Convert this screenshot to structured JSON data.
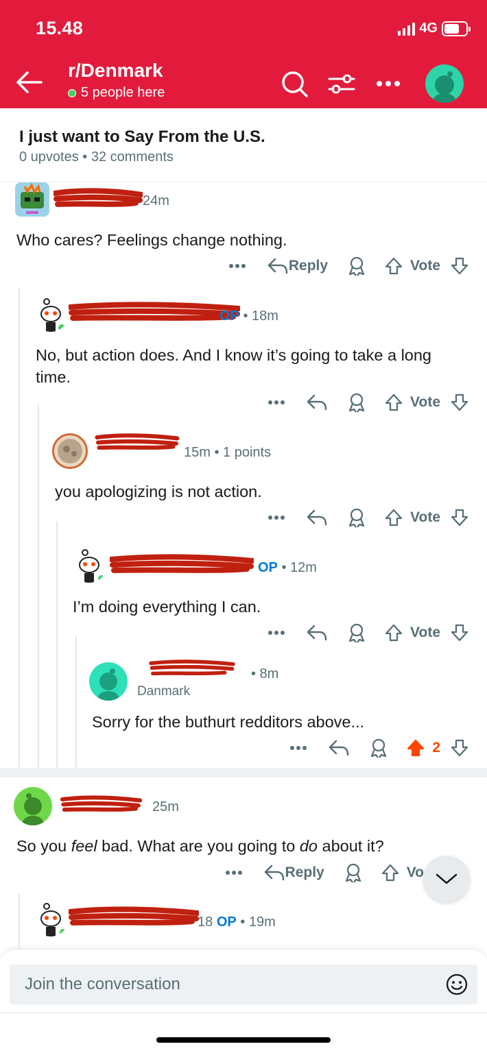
{
  "status": {
    "time": "15.48",
    "network": "4G"
  },
  "header": {
    "subreddit": "r/Denmark",
    "online": "5 people here"
  },
  "post": {
    "title": "I just want to Say From the U.S.",
    "meta": "0 upvotes • 32 comments"
  },
  "comments": [
    {
      "meta": "24m",
      "body": "Who cares? Feelings change nothing.",
      "reply": "Reply",
      "vote": "Vote"
    },
    {
      "op": "OP",
      "meta": " • 18m",
      "body": "No, but action does. And I know it’s going to take a long time.",
      "vote": "Vote"
    },
    {
      "meta": "15m • 1 points",
      "body": "you apologizing is not action.",
      "vote": "Vote"
    },
    {
      "op": "OP",
      "meta": " • 12m",
      "body": "I’m doing everything I can.",
      "vote": "Vote"
    },
    {
      "meta": "• 8m",
      "flair": "Danmark",
      "body": "Sorry for the buthurt redditors above...",
      "score": "2"
    },
    {
      "meta": "25m",
      "body_parts": [
        "So you ",
        "feel",
        " bad. What are you going to ",
        "do",
        " about it?"
      ],
      "reply": "Reply",
      "vote": "Vo"
    },
    {
      "op_prefix": "18",
      "op": "OP",
      "meta": " • 19m"
    }
  ],
  "composer": {
    "placeholder": "Join the conversation"
  },
  "colors": {
    "brand": "#e21b3c",
    "upvote": "#ff4500",
    "op": "#0079d3",
    "online": "#46d160"
  }
}
